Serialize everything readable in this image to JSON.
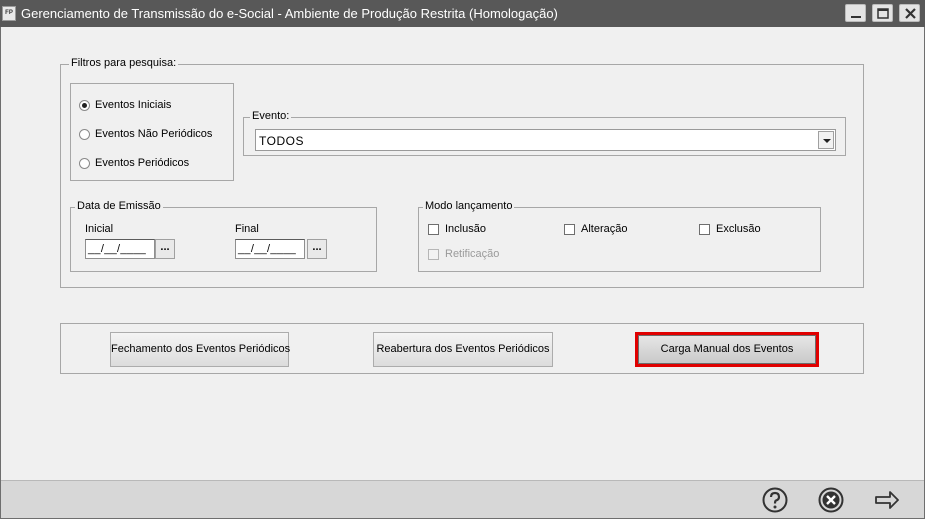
{
  "window": {
    "app_icon_label": "FP",
    "title": "Gerenciamento de Transmissão do e-Social - Ambiente de Produção Restrita (Homologação)",
    "controls": [
      "minimize-icon",
      "maximize-icon",
      "close-icon"
    ]
  },
  "filters": {
    "legend": "Filtros para pesquisa:",
    "event_types": [
      {
        "label": "Eventos Iniciais",
        "selected": true
      },
      {
        "label": "Eventos Não Periódicos",
        "selected": false
      },
      {
        "label": "Eventos Periódicos",
        "selected": false
      }
    ],
    "evento": {
      "legend": "Evento:",
      "value": "TODOS"
    },
    "data_emissao": {
      "legend": "Data de Emissão",
      "inicial": {
        "label": "Inicial",
        "value": "__/__/____",
        "button": "..."
      },
      "final": {
        "label": "Final",
        "value": "__/__/____",
        "button": "..."
      }
    },
    "modo_lancamento": {
      "legend": "Modo lançamento",
      "options": [
        {
          "label": "Inclusão",
          "checked": false,
          "enabled": true
        },
        {
          "label": "Alteração",
          "checked": false,
          "enabled": true
        },
        {
          "label": "Exclusão",
          "checked": false,
          "enabled": true
        },
        {
          "label": "Retificação",
          "checked": false,
          "enabled": false
        }
      ]
    }
  },
  "actions": {
    "fechamento": "Fechamento dos Eventos Periódicos",
    "reabertura": "Reabertura dos Eventos Periódicos",
    "carga_manual": "Carga Manual dos Eventos",
    "highlight_color": "#e00000"
  },
  "footer": {
    "icons": [
      "help-icon",
      "cancel-icon",
      "next-arrow-icon"
    ]
  },
  "colors": {
    "titlebar": "#585858",
    "client_bg": "#f0f0f0",
    "footer_bg": "#d7d7d7"
  }
}
